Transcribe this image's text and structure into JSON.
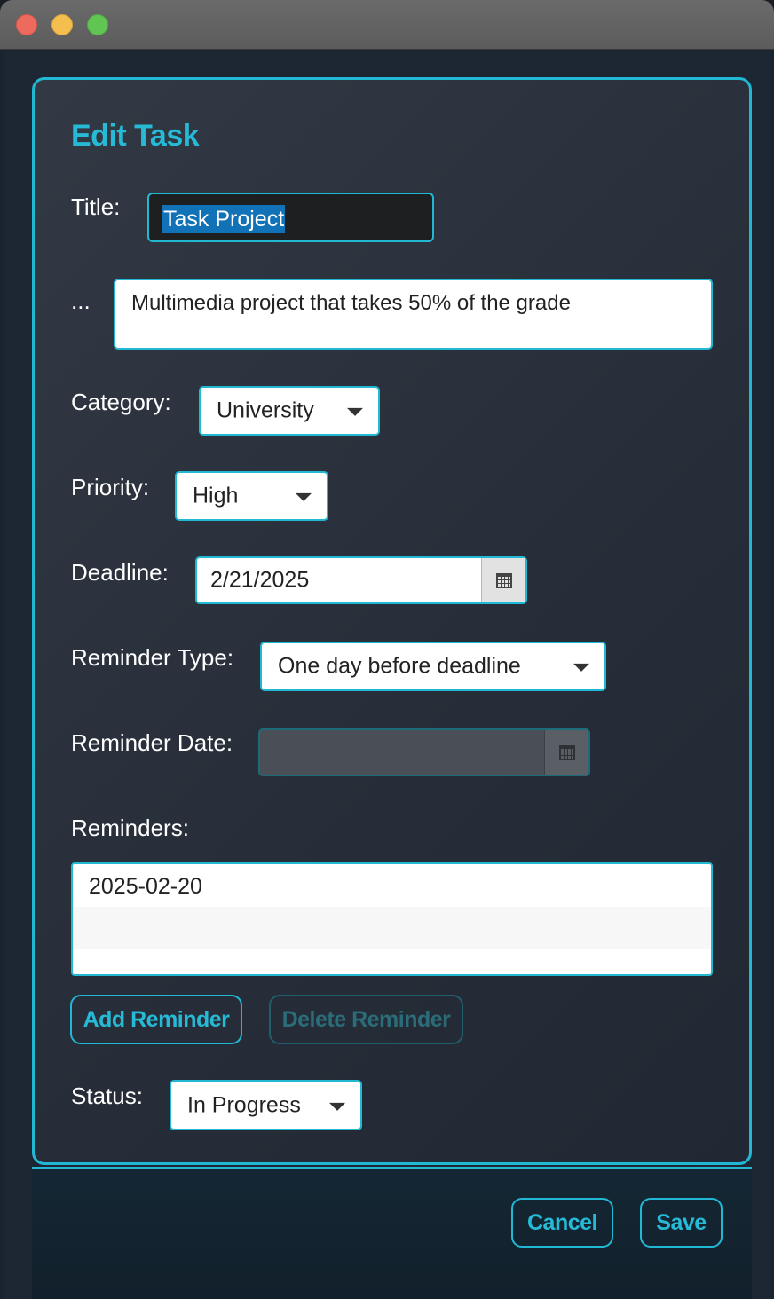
{
  "dialog": {
    "heading": "Edit Task",
    "labels": {
      "title": "Title:",
      "description": "...",
      "category": "Category:",
      "priority": "Priority:",
      "deadline": "Deadline:",
      "reminder_type": "Reminder Type:",
      "reminder_date": "Reminder Date:",
      "reminders": "Reminders:",
      "status": "Status:"
    },
    "fields": {
      "title": "Task Project",
      "description": "Multimedia project that takes 50% of the grade",
      "category": "University",
      "priority": "High",
      "deadline": "2/21/2025",
      "reminder_type": "One day before deadline",
      "reminder_date": "",
      "status": "In Progress"
    },
    "reminders": [
      "2025-02-20"
    ],
    "buttons": {
      "add_reminder": "Add Reminder",
      "delete_reminder": "Delete Reminder",
      "cancel": "Cancel",
      "save": "Save"
    }
  },
  "colors": {
    "accent": "#21b8d3",
    "selection": "#1272b8",
    "panel": "#2a313c"
  },
  "icons": [
    "calendar-icon",
    "chevron-down-icon"
  ]
}
